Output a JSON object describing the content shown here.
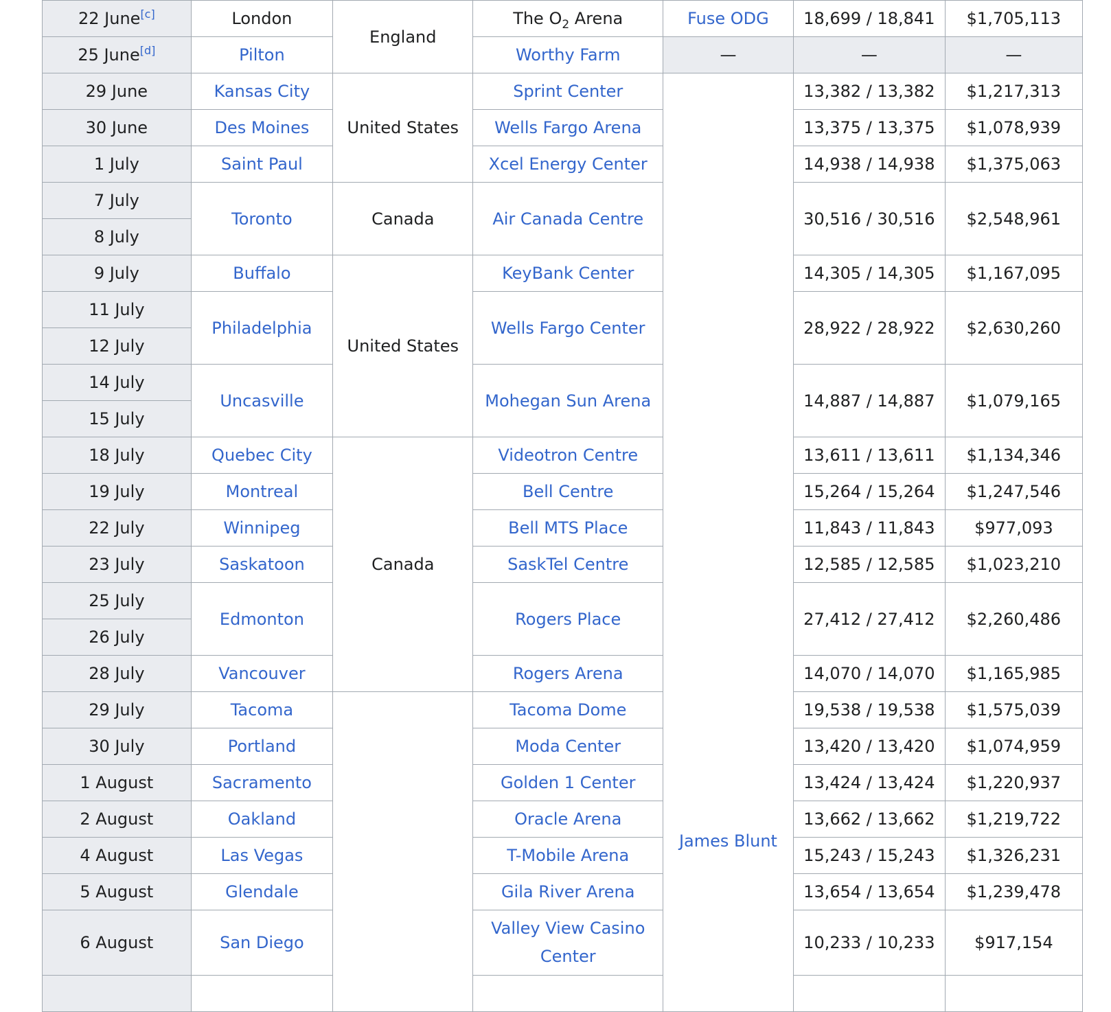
{
  "rows": [
    {
      "date": "22 June",
      "note": "[c]",
      "city": "London",
      "country": "England",
      "venue_pre": "The O",
      "venue_sub": "2",
      "venue_post": " Arena",
      "opener": "Fuse ODG",
      "attendance": "18,699 / 18,841",
      "revenue": "$1,705,113"
    },
    {
      "date": "25 June",
      "note": "[d]",
      "city": "Pilton",
      "venue": "Worthy Farm",
      "opener": "—",
      "attendance": "—",
      "revenue": "—"
    },
    {
      "date": "29 June",
      "city": "Kansas City",
      "country": "United States",
      "venue": "Sprint Center",
      "opener": "James Blunt",
      "attendance": "13,382 / 13,382",
      "revenue": "$1,217,313"
    },
    {
      "date": "30 June",
      "city": "Des Moines",
      "venue": "Wells Fargo Arena",
      "attendance": "13,375 / 13,375",
      "revenue": "$1,078,939"
    },
    {
      "date": "1 July",
      "city": "Saint Paul",
      "venue": "Xcel Energy Center",
      "attendance": "14,938 / 14,938",
      "revenue": "$1,375,063"
    },
    {
      "date": "7 July",
      "city": "Toronto",
      "country": "Canada",
      "venue": "Air Canada Centre",
      "attendance": "30,516 / 30,516",
      "revenue": "$2,548,961"
    },
    {
      "date": "8 July"
    },
    {
      "date": "9 July",
      "city": "Buffalo",
      "country": "United States",
      "venue": "KeyBank Center",
      "attendance": "14,305 / 14,305",
      "revenue": "$1,167,095"
    },
    {
      "date": "11 July",
      "city": "Philadelphia",
      "venue": "Wells Fargo Center",
      "attendance": "28,922 / 28,922",
      "revenue": "$2,630,260"
    },
    {
      "date": "12 July"
    },
    {
      "date": "14 July",
      "city": "Uncasville",
      "venue": "Mohegan Sun Arena",
      "attendance": "14,887 / 14,887",
      "revenue": "$1,079,165"
    },
    {
      "date": "15 July"
    },
    {
      "date": "18 July",
      "city": "Quebec City",
      "country": "Canada",
      "venue": "Videotron Centre",
      "attendance": "13,611 / 13,611",
      "revenue": "$1,134,346"
    },
    {
      "date": "19 July",
      "city": "Montreal",
      "venue": "Bell Centre",
      "attendance": "15,264 / 15,264",
      "revenue": "$1,247,546"
    },
    {
      "date": "22 July",
      "city": "Winnipeg",
      "venue": "Bell MTS Place",
      "attendance": "11,843 / 11,843",
      "revenue": "$977,093"
    },
    {
      "date": "23 July",
      "city": "Saskatoon",
      "venue": "SaskTel Centre",
      "attendance": "12,585 / 12,585",
      "revenue": "$1,023,210"
    },
    {
      "date": "25 July",
      "city": "Edmonton",
      "venue": "Rogers Place",
      "attendance": "27,412 / 27,412",
      "revenue": "$2,260,486"
    },
    {
      "date": "26 July"
    },
    {
      "date": "28 July",
      "city": "Vancouver",
      "venue": "Rogers Arena",
      "attendance": "14,070 / 14,070",
      "revenue": "$1,165,985"
    },
    {
      "date": "29 July",
      "city": "Tacoma",
      "venue": "Tacoma Dome",
      "attendance": "19,538 / 19,538",
      "revenue": "$1,575,039"
    },
    {
      "date": "30 July",
      "city": "Portland",
      "venue": "Moda Center",
      "attendance": "13,420 / 13,420",
      "revenue": "$1,074,959"
    },
    {
      "date": "1 August",
      "city": "Sacramento",
      "venue": "Golden 1 Center",
      "attendance": "13,424 / 13,424",
      "revenue": "$1,220,937"
    },
    {
      "date": "2 August",
      "city": "Oakland",
      "venue": "Oracle Arena",
      "attendance": "13,662 / 13,662",
      "revenue": "$1,219,722"
    },
    {
      "date": "4 August",
      "city": "Las Vegas",
      "venue": "T-Mobile Arena",
      "attendance": "15,243 / 15,243",
      "revenue": "$1,326,231"
    },
    {
      "date": "5 August",
      "city": "Glendale",
      "venue": "Gila River Arena",
      "attendance": "13,654 / 13,654",
      "revenue": "$1,239,478"
    },
    {
      "date": "6 August",
      "city": "San Diego",
      "venue": "Valley View Casino Center",
      "attendance": "10,233 / 10,233",
      "revenue": "$917,154"
    }
  ]
}
